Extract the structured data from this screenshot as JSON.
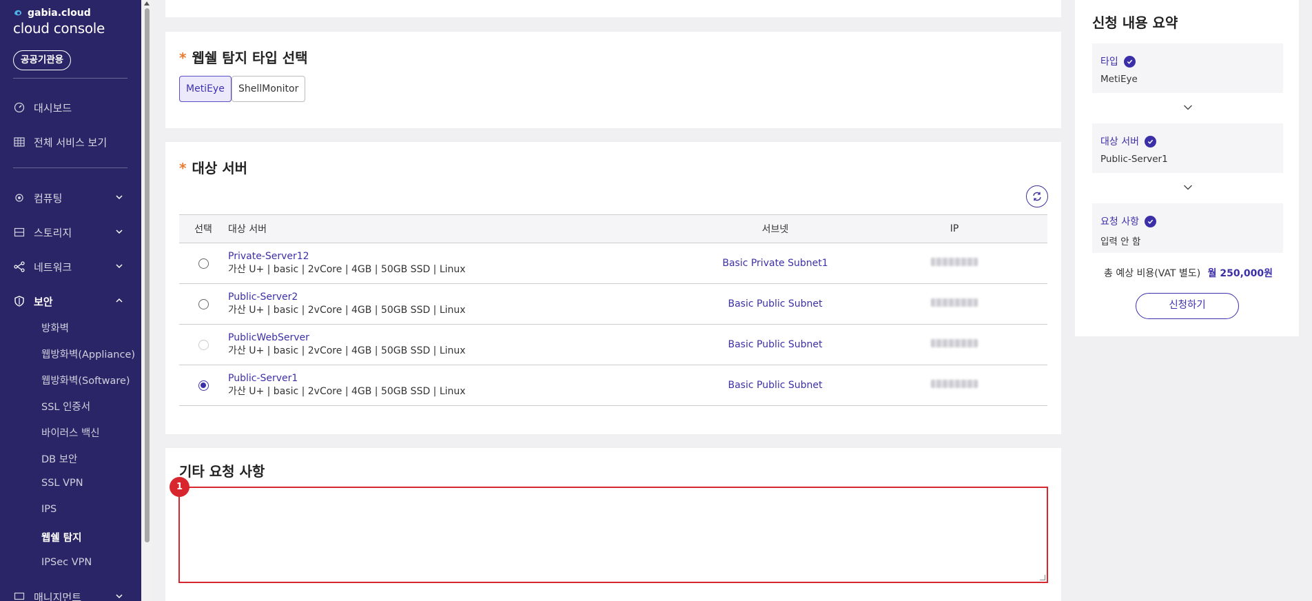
{
  "sidebar": {
    "brand_small": "gabia.cloud",
    "brand_main": "cloud console",
    "pill": "공공기관용",
    "items": [
      {
        "label": "대시보드",
        "icon": "dashboard-icon"
      },
      {
        "label": "전체 서비스 보기",
        "icon": "grid-icon"
      },
      {
        "label": "컴퓨팅",
        "icon": "cpu-icon"
      },
      {
        "label": "스토리지",
        "icon": "storage-icon"
      },
      {
        "label": "네트워크",
        "icon": "network-icon"
      },
      {
        "label": "보안",
        "icon": "shield-icon"
      },
      {
        "label": "매니지먼트",
        "icon": "management-icon"
      }
    ],
    "security_sub": [
      "방화벽",
      "웹방화벽(Appliance)",
      "웹방화벽(Software)",
      "SSL 인증서",
      "바이러스 백신",
      "DB 보안",
      "SSL VPN",
      "IPS",
      "웹쉘 탐지",
      "IPSec VPN"
    ]
  },
  "type_section": {
    "title": "웹쉘 탐지 타입 선택",
    "options": [
      "MetiEye",
      "ShellMonitor"
    ],
    "selected": "MetiEye"
  },
  "server_section": {
    "title": "대상 서버",
    "headers": [
      "선택",
      "대상 서버",
      "서브넷",
      "IP"
    ],
    "rows": [
      {
        "name": "Private-Server12",
        "spec": "가산 U+ | basic | 2vCore | 4GB | 50GB SSD | Linux",
        "subnet": "Basic Private Subnet1",
        "state": "unchecked"
      },
      {
        "name": "Public-Server2",
        "spec": "가산 U+ | basic | 2vCore | 4GB | 50GB SSD | Linux",
        "subnet": "Basic Public Subnet",
        "state": "unchecked"
      },
      {
        "name": "PublicWebServer",
        "spec": "가산 U+ | basic | 2vCore | 4GB | 50GB SSD | Linux",
        "subnet": "Basic Public Subnet",
        "state": "disabled"
      },
      {
        "name": "Public-Server1",
        "spec": "가산 U+ | basic | 2vCore | 4GB | 50GB SSD | Linux",
        "subnet": "Basic Public Subnet",
        "state": "checked"
      }
    ]
  },
  "request_section": {
    "title": "기타 요청 사항",
    "textarea_value": "",
    "badge": "1"
  },
  "summary": {
    "title": "신청 내용 요약",
    "items": [
      {
        "label": "타입",
        "value": "MetiEye"
      },
      {
        "label": "대상 서버",
        "value": "Public-Server1"
      },
      {
        "label": "요청 사항",
        "value": "입력 안 함"
      }
    ],
    "total_label": "총 예상 비용(VAT 별도)",
    "total_price": "월 250,000원",
    "apply_label": "신청하기"
  },
  "colors": {
    "sidebar_bg": "#2a2566",
    "accent": "#3b2fa8",
    "required_star": "#e8792e",
    "highlight": "#d8262e"
  }
}
